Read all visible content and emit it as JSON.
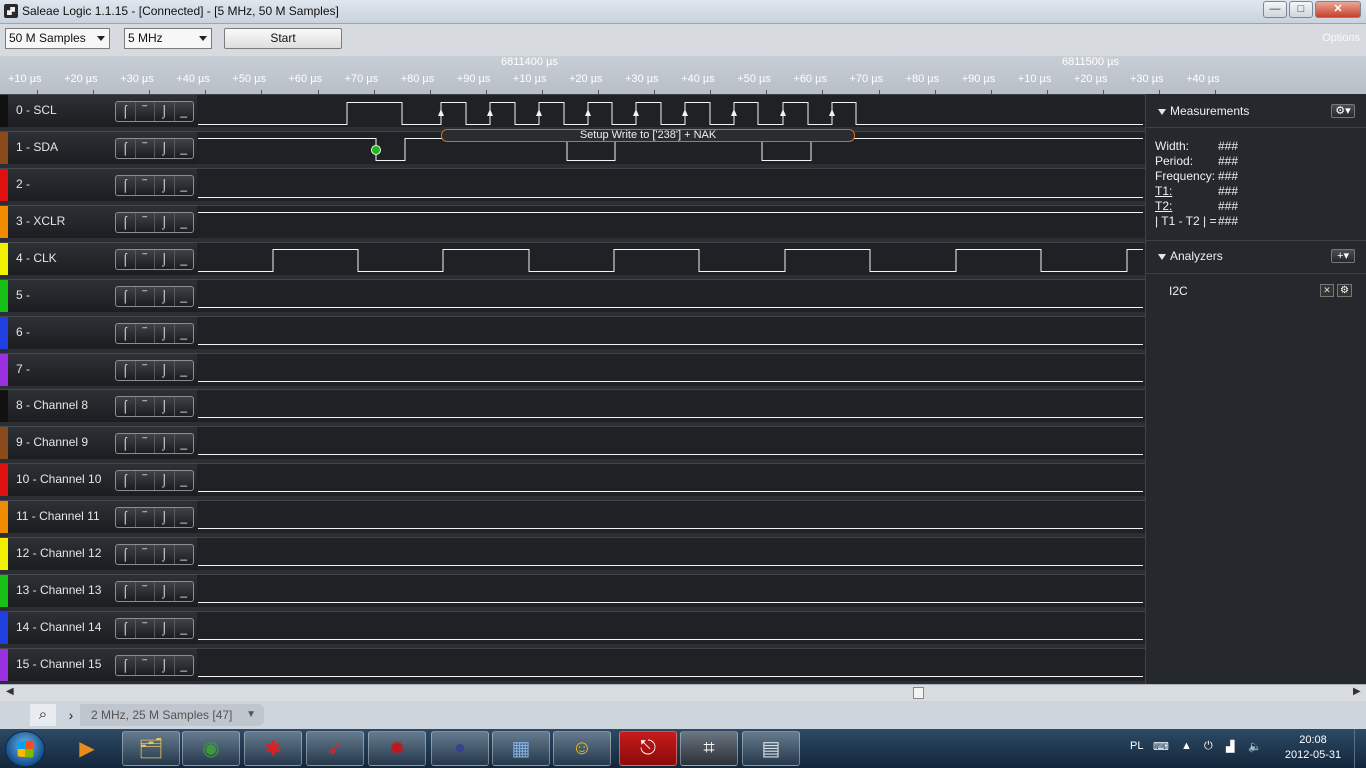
{
  "window": {
    "title": "Saleae Logic 1.1.15 - [Connected] - [5 MHz, 50 M Samples]",
    "minimize": "—",
    "maximize": "□",
    "close": "✕"
  },
  "toolbar": {
    "samples_select": "50 M Samples",
    "rate_select": "5 MHz",
    "start_button": "Start",
    "options_label": "Options"
  },
  "ruler": {
    "major_labels": [
      "6811400 µs",
      "6811500 µs"
    ],
    "tick_labels": [
      "+10 µs",
      "+20 µs",
      "+30 µs",
      "+40 µs",
      "+50 µs",
      "+60 µs",
      "+70 µs",
      "+80 µs",
      "+90 µs",
      "+10 µs",
      "+20 µs",
      "+30 µs",
      "+40 µs",
      "+50 µs",
      "+60 µs",
      "+70 µs",
      "+80 µs",
      "+90 µs",
      "+10 µs",
      "+20 µs",
      "+30 µs",
      "+40 µs"
    ]
  },
  "channels": [
    {
      "name": "0 - SCL",
      "color": "#111111"
    },
    {
      "name": "1 - SDA",
      "color": "#8a4a1c"
    },
    {
      "name": "2 -",
      "color": "#e01010"
    },
    {
      "name": "3 - XCLR",
      "color": "#f08a00"
    },
    {
      "name": "4 - CLK",
      "color": "#f2f200"
    },
    {
      "name": "5 -",
      "color": "#17c017"
    },
    {
      "name": "6 -",
      "color": "#1f3fe0"
    },
    {
      "name": "7 -",
      "color": "#9a30e0"
    },
    {
      "name": "8 - Channel 8",
      "color": "#111111"
    },
    {
      "name": "9 - Channel 9",
      "color": "#8a4a1c"
    },
    {
      "name": "10 - Channel 10",
      "color": "#e01010"
    },
    {
      "name": "11 - Channel 11",
      "color": "#f08a00"
    },
    {
      "name": "12 - Channel 12",
      "color": "#f2f200"
    },
    {
      "name": "13 - Channel 13",
      "color": "#17c017"
    },
    {
      "name": "14 - Channel 14",
      "color": "#1f3fe0"
    },
    {
      "name": "15 - Channel 15",
      "color": "#9a30e0"
    }
  ],
  "trigger_glyphs": [
    "⌠",
    "‾",
    "⌡",
    "_"
  ],
  "decode_bubble": "Setup Write to ['238'] + NAK",
  "measurements": {
    "header": "Measurements",
    "rows": [
      {
        "label": "Width:",
        "value": "###"
      },
      {
        "label": "Period:",
        "value": "###"
      },
      {
        "label": "Frequency:",
        "value": "###"
      },
      {
        "label": "T1:",
        "value": "###"
      },
      {
        "label": "T2:",
        "value": "###"
      },
      {
        "label": "| T1 - T2 | =",
        "value": "###"
      }
    ]
  },
  "analyzers": {
    "header": "Analyzers",
    "items": [
      {
        "name": "I2C"
      }
    ],
    "add_button": "+▾",
    "remove_icon": "✕",
    "settings_icon": "⚙"
  },
  "statusbar": {
    "capture_tab": "2 MHz, 25 M Samples [47]"
  },
  "taskbar": {
    "language": "PL",
    "time": "20:08",
    "date": "2012-05-31",
    "apps": [
      "media-player-icon",
      "file-explorer-icon",
      "chrome-icon",
      "red-app-icon",
      "red-bird-app-icon",
      "ladybug-app-icon",
      "eclipse-icon",
      "control-panel-icon",
      "smiley-app-icon",
      "pdf-reader-icon",
      "saleae-logic-icon",
      "calculator-icon"
    ]
  }
}
